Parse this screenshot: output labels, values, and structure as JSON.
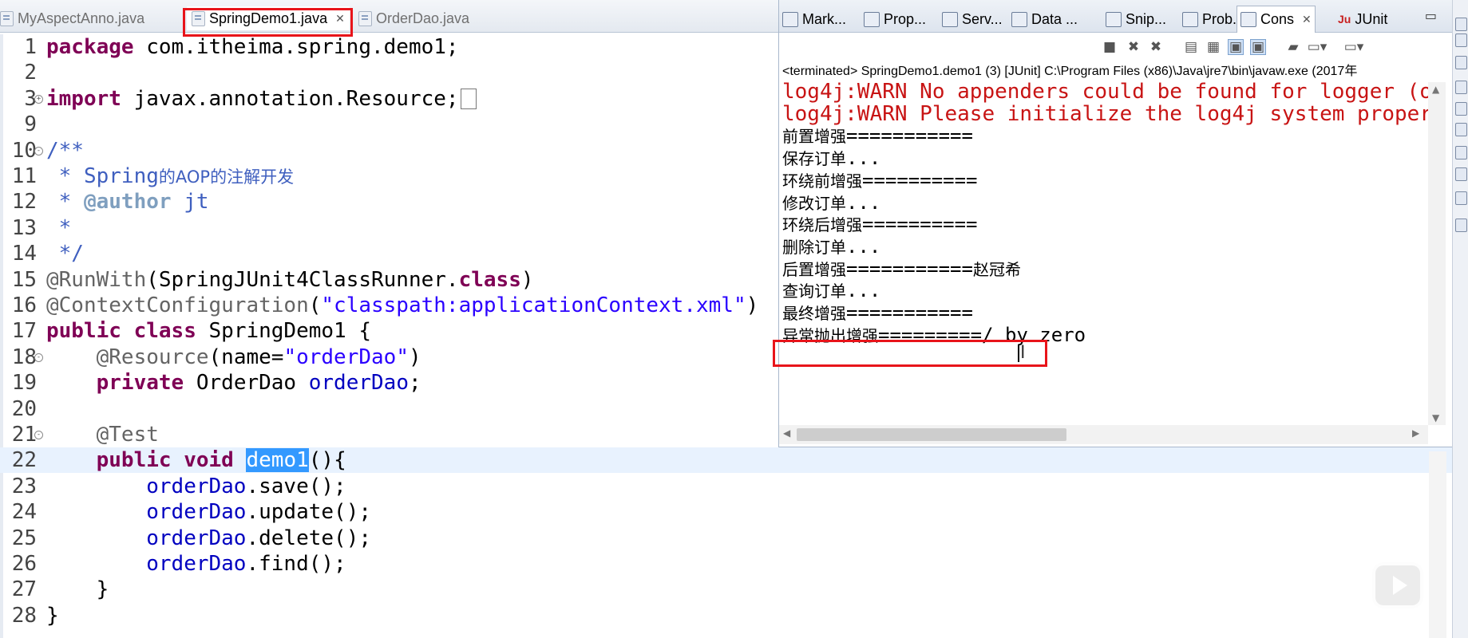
{
  "editor": {
    "tabs": [
      {
        "label": "MyAspectAnno.java"
      },
      {
        "label": "SpringDemo1.java",
        "close": "✕"
      },
      {
        "label": "OrderDao.java"
      }
    ],
    "lines": [
      {
        "n": "1",
        "parts": [
          {
            "t": "package",
            "c": "kw"
          },
          {
            "t": " com.itheima.spring.demo1;"
          }
        ]
      },
      {
        "n": "2",
        "parts": []
      },
      {
        "n": "3",
        "fold": "+",
        "parts": [
          {
            "t": "import",
            "c": "kw"
          },
          {
            "t": " javax.annotation.Resource;"
          },
          {
            "box": true
          }
        ]
      },
      {
        "n": "9",
        "parts": []
      },
      {
        "n": "10",
        "fold": "-",
        "parts": [
          {
            "t": "/**",
            "c": "cmt"
          }
        ]
      },
      {
        "n": "11",
        "parts": [
          {
            "t": " * Spring",
            "c": "cmt"
          },
          {
            "t": "的AOP的注解开发",
            "c": "cjk"
          }
        ]
      },
      {
        "n": "12",
        "parts": [
          {
            "t": " * ",
            "c": "cmt"
          },
          {
            "t": "@author",
            "c": "tag-doc"
          },
          {
            "t": " jt",
            "c": "cmt"
          }
        ]
      },
      {
        "n": "13",
        "parts": [
          {
            "t": " *",
            "c": "cmt"
          }
        ]
      },
      {
        "n": "14",
        "parts": [
          {
            "t": " */",
            "c": "cmt"
          }
        ]
      },
      {
        "n": "15",
        "parts": [
          {
            "t": "@RunWith",
            "c": "ann"
          },
          {
            "t": "(SpringJUnit4ClassRunner."
          },
          {
            "t": "class",
            "c": "kw"
          },
          {
            "t": ")"
          }
        ]
      },
      {
        "n": "16",
        "parts": [
          {
            "t": "@ContextConfiguration",
            "c": "ann"
          },
          {
            "t": "("
          },
          {
            "t": "\"classpath:applicationContext.xml\"",
            "c": "str"
          },
          {
            "t": ")"
          }
        ]
      },
      {
        "n": "17",
        "parts": [
          {
            "t": "public",
            "c": "kw"
          },
          {
            "t": " "
          },
          {
            "t": "class",
            "c": "kw"
          },
          {
            "t": " SpringDemo1 {"
          }
        ]
      },
      {
        "n": "18",
        "fold": "-",
        "parts": [
          {
            "t": "    "
          },
          {
            "t": "@Resource",
            "c": "ann"
          },
          {
            "t": "(name="
          },
          {
            "t": "\"orderDao\"",
            "c": "str"
          },
          {
            "t": ")"
          }
        ]
      },
      {
        "n": "19",
        "parts": [
          {
            "t": "    "
          },
          {
            "t": "private",
            "c": "kw"
          },
          {
            "t": " OrderDao "
          },
          {
            "t": "orderDao",
            "c": "fld"
          },
          {
            "t": ";"
          }
        ]
      },
      {
        "n": "20",
        "parts": []
      },
      {
        "n": "21",
        "fold": "-",
        "parts": [
          {
            "t": "    "
          },
          {
            "t": "@Test",
            "c": "ann"
          }
        ]
      },
      {
        "n": "22",
        "current": true,
        "parts": [
          {
            "t": "    "
          },
          {
            "t": "public",
            "c": "kw"
          },
          {
            "t": " "
          },
          {
            "t": "void",
            "c": "kw"
          },
          {
            "t": " "
          },
          {
            "t": "demo1",
            "c": "sel"
          },
          {
            "t": "(){"
          }
        ]
      },
      {
        "n": "23",
        "parts": [
          {
            "t": "        "
          },
          {
            "t": "orderDao",
            "c": "fld"
          },
          {
            "t": ".save();"
          }
        ]
      },
      {
        "n": "24",
        "parts": [
          {
            "t": "        "
          },
          {
            "t": "orderDao",
            "c": "fld"
          },
          {
            "t": ".update();"
          }
        ]
      },
      {
        "n": "25",
        "parts": [
          {
            "t": "        "
          },
          {
            "t": "orderDao",
            "c": "fld"
          },
          {
            "t": ".delete();"
          }
        ]
      },
      {
        "n": "26",
        "parts": [
          {
            "t": "        "
          },
          {
            "t": "orderDao",
            "c": "fld"
          },
          {
            "t": ".find();"
          }
        ]
      },
      {
        "n": "27",
        "parts": [
          {
            "t": "    }"
          }
        ]
      },
      {
        "n": "28",
        "parts": [
          {
            "t": "}"
          }
        ]
      }
    ]
  },
  "views": {
    "tabs": [
      {
        "label": "Mark..."
      },
      {
        "label": "Prop..."
      },
      {
        "label": "Serv..."
      },
      {
        "label": "Data ..."
      },
      {
        "label": "Snip..."
      },
      {
        "label": "Prob..."
      },
      {
        "label": "Cons",
        "close": "✕"
      },
      {
        "label": "JUnit",
        "icon_text": "Ju"
      }
    ],
    "minimize": "▭"
  },
  "console": {
    "status": "<terminated> SpringDemo1.demo1 (3) [JUnit] C:\\Program Files (x86)\\Java\\jre7\\bin\\javaw.exe (2017年",
    "lines": [
      {
        "text": "log4j:WARN No appenders could be found for logger (o",
        "err": true
      },
      {
        "text": "log4j:WARN Please initialize the log4j system proper",
        "err": true
      },
      {
        "zh": "前置增强",
        "text": "==========="
      },
      {
        "zh": "保存订单",
        "text": "..."
      },
      {
        "zh": "环绕前增强",
        "text": "=========="
      },
      {
        "zh": "修改订单",
        "text": "..."
      },
      {
        "zh": "环绕后增强",
        "text": "=========="
      },
      {
        "zh": "删除订单",
        "text": "..."
      },
      {
        "zh": "后置增强",
        "text": "===========",
        "zh2": "赵冠希"
      },
      {
        "zh": "查询订单",
        "text": "..."
      },
      {
        "zh": "最终增强",
        "text": "==========="
      },
      {
        "zh": "异常抛出增强",
        "text": "=========/ by zero"
      }
    ],
    "toolbar_icons": [
      "terminate-icon",
      "remove-launch-icon",
      "remove-all-icon",
      "scroll-lock-icon",
      "word-wrap-icon",
      "show-console-out-icon",
      "show-console-err-icon",
      "pin-console-icon",
      "display-console-icon",
      "open-console-icon"
    ]
  }
}
